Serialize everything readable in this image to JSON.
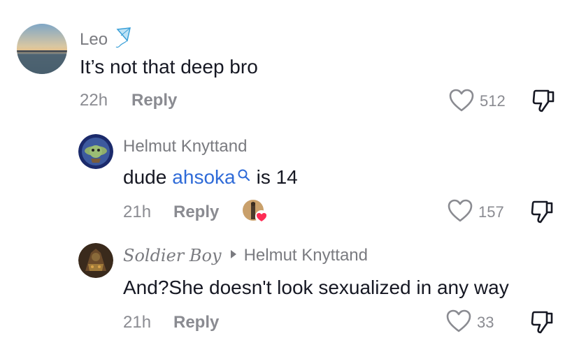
{
  "comments": [
    {
      "username": "Leo",
      "text": "It’s not that deep bro",
      "time": "22h",
      "reply_label": "Reply",
      "likes": "512",
      "avatar": "sea-sunset-avatar"
    },
    {
      "username": "Helmut Knyttand",
      "text_before": "dude",
      "mention": "ahsoka",
      "text_after": "is 14",
      "time": "21h",
      "reply_label": "Reply",
      "likes": "157",
      "avatar": "yoda-avatar"
    },
    {
      "username": "Soldier Boy",
      "reply_to": "Helmut Knyttand",
      "text": "And?She doesn't look sexualized in any way",
      "time": "21h",
      "reply_label": "Reply",
      "likes": "33",
      "avatar": "armored-warrior-avatar"
    }
  ],
  "colors": {
    "mention": "#2f6bd8",
    "muted": "#8a8b91",
    "text": "#161823"
  }
}
